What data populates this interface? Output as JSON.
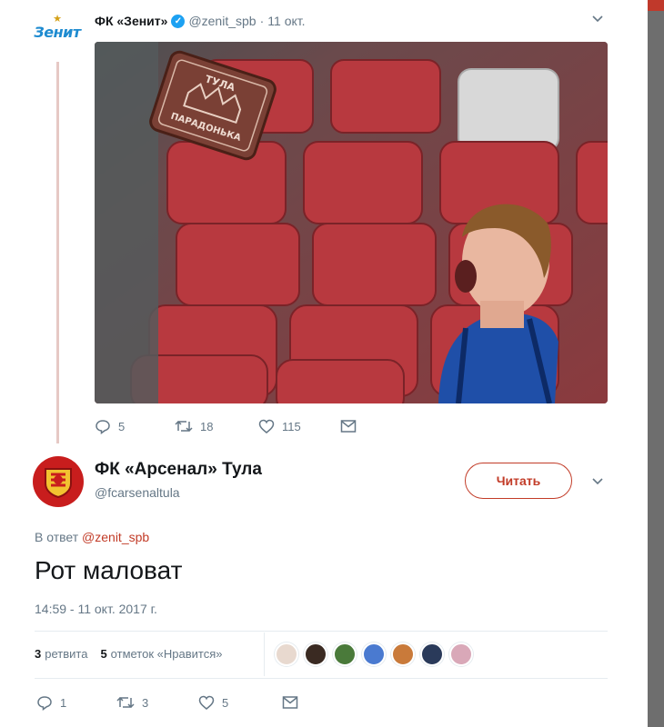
{
  "tweet1": {
    "avatar_text": "Зенит",
    "name": "ФК «Зенит»",
    "handle": "@zenit_spb",
    "separator": "·",
    "date": "11 окт.",
    "image_caption": "ТУЛА ПАРАДОНЬКА",
    "replies": "5",
    "retweets": "18",
    "likes": "115"
  },
  "tweet2": {
    "name": "ФК «Арсенал» Тула",
    "handle": "@fcarsenaltula",
    "follow_label": "Читать",
    "reply_prefix": "В ответ",
    "reply_mention": "@zenit_spb",
    "text": "Рот маловат",
    "timestamp": "14:59 - 11 окт. 2017 г.",
    "retweets_count": "3",
    "retweets_label": "ретвита",
    "likes_count": "5",
    "likes_label": "отметок «Нравится»",
    "replies": "1",
    "retweets": "3",
    "likes": "5"
  },
  "colors": {
    "accent": "#c23b27",
    "twitter_gray": "#657786",
    "verified": "#1da1f2",
    "zenit_blue": "#1e8bd0",
    "arsenal_red": "#c81d1d"
  },
  "icons": [
    "chevron-down-icon",
    "reply-icon",
    "retweet-icon",
    "like-icon",
    "dm-icon",
    "verified-icon"
  ]
}
